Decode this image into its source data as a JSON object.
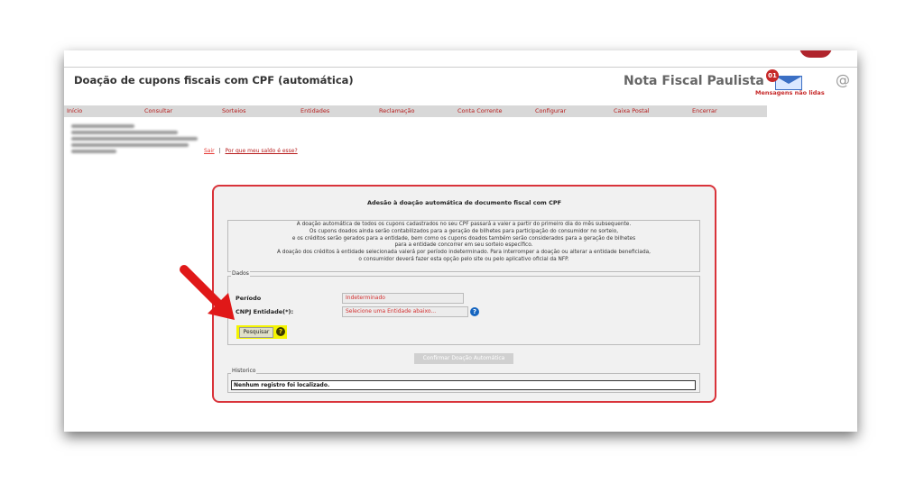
{
  "header": {
    "title": "Doação de cupons fiscais com CPF (automática)",
    "brand": "Nota Fiscal Paulista",
    "messages_badge": "01",
    "messages_label": "Mensagens não lidas"
  },
  "menu": {
    "items": [
      "Início",
      "Consultar",
      "Sorteios",
      "Entidades",
      "Reclamação",
      "Conta Corrente",
      "Configurar",
      "Caixa Postal",
      "Encerrar"
    ]
  },
  "user_info": {
    "logout": "Sair",
    "separator": "|",
    "balance_link": "Por que meu saldo é esse?"
  },
  "panel": {
    "title": "Adesão à doação automática de documento fiscal com CPF",
    "notice_lines": [
      "A doação automática de todos os cupons cadastrados no seu CPF passará a valer a partir do primeiro dia do mês subsequente.",
      "Os cupons doados ainda serão contabilizados para a geração de bilhetes para participação do consumidor no sorteio,",
      "e os créditos serão gerados para a entidade, bem como os cupons doados também serão considerados para a geração de bilhetes",
      "para a entidade concorrer em seu sorteio específico.",
      "A doação dos créditos à entidade selecionada valerá por período indeterminado. Para interromper a doação ou alterar a entidade beneficiada,",
      "o consumidor deverá fazer esta opção pelo site ou pelo aplicativo oficial da NFP."
    ],
    "dados_legend": "Dados",
    "periodo_label": "Período",
    "periodo_value": "Indeterminado",
    "cnpj_label": "CNPJ Entidade(*):",
    "cnpj_value": "Selecione uma Entidade abaixo...",
    "search_button": "Pesquisar",
    "confirm_button": "Confirmar Doação Automática",
    "historico_legend": "Historico",
    "historico_value": "Nenhum registro foi localizado."
  },
  "colors": {
    "accent_red": "#d9333a",
    "highlight": "#f4f400",
    "menu_text": "#b71c1c"
  }
}
